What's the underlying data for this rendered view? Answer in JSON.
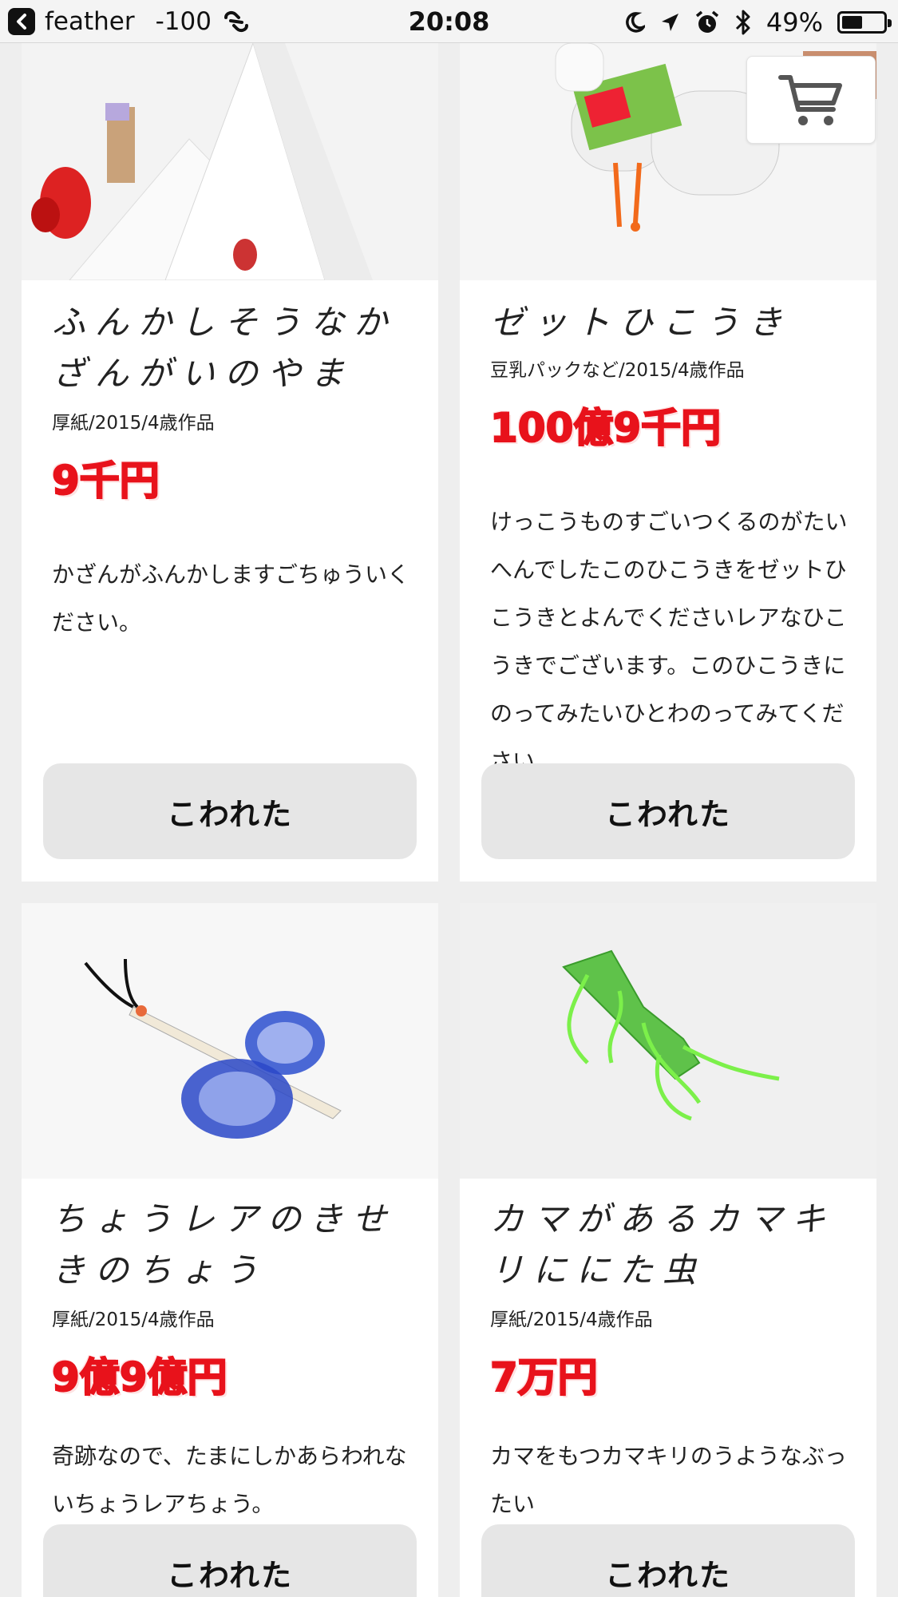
{
  "status_bar": {
    "back_app": "feather",
    "signal": "-100",
    "time": "20:08",
    "battery": "49%",
    "battery_level": 0.49
  },
  "cart": {
    "icon": "cart-icon"
  },
  "products": [
    {
      "title": "ふんかしそうなかざんがいのやま",
      "meta": "厚紙/2015/4歳作品",
      "price": "9千円",
      "description": "かざんがふんかしますごちゅういください。",
      "button": "こわれた"
    },
    {
      "title": "ゼットひこうき",
      "meta": "豆乳パックなど/2015/4歳作品",
      "price": "100億9千円",
      "description": "けっこうものすごいつくるのがたいへんでしたこのひこうきをゼットひこうきとよんでくださいレアなひこうきでございます。このひこうきにのってみたいひとわのってみてください。",
      "button": "こわれた"
    },
    {
      "title": "ちょうレアのきせきのちょう",
      "meta": "厚紙/2015/4歳作品",
      "price": "9億9億円",
      "description": "奇跡なので、たまにしかあらわれないちょうレアちょう。",
      "button": "こわれた"
    },
    {
      "title": "カマがあるカマキリににた虫",
      "meta": "厚紙/2015/4歳作品",
      "price": "7万円",
      "description": "カマをもつカマキリのうようなぶったい",
      "button": "こわれた"
    }
  ],
  "colors": {
    "price": "#e8121b",
    "background": "#eeeeee",
    "button": "#e6e6e6"
  }
}
